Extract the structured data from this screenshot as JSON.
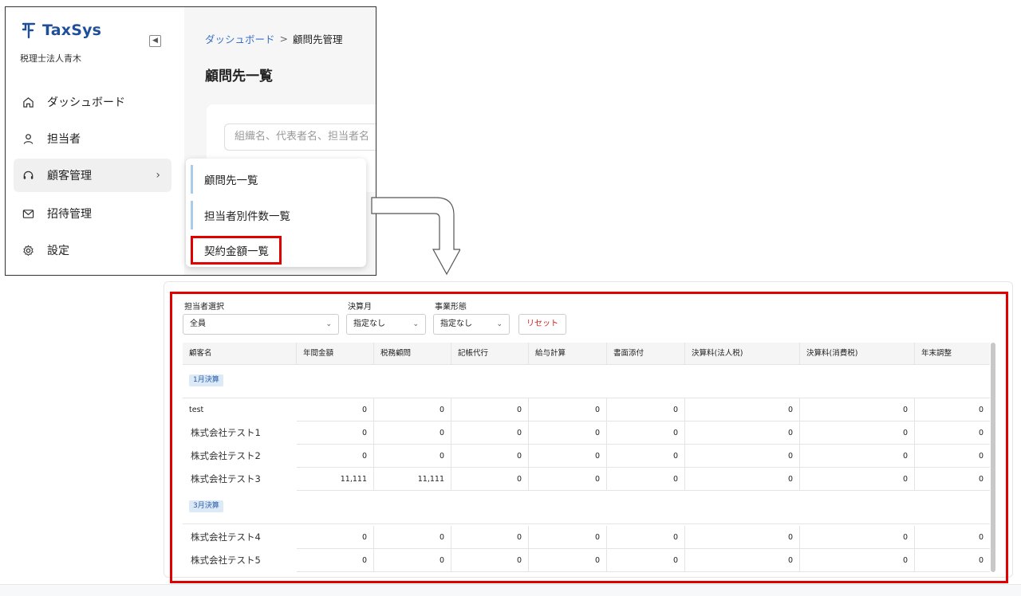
{
  "app": {
    "brand": "TaxSys",
    "org": "税理士法人青木",
    "nav": [
      {
        "label": "ダッシュボード",
        "icon": "home-icon"
      },
      {
        "label": "担当者",
        "icon": "user-icon"
      },
      {
        "label": "顧客管理",
        "icon": "headset-icon",
        "chevron": "›"
      },
      {
        "label": "招待管理",
        "icon": "mail-icon"
      },
      {
        "label": "設定",
        "icon": "gear-icon"
      }
    ],
    "breadcrumb": {
      "parent": "ダッシュボード",
      "sep": ">",
      "current": "顧問先管理"
    },
    "page_title": "顧問先一覧",
    "search_placeholder": "組織名、代表者名、担当者名",
    "flyout": [
      "顧問先一覧",
      "担当者別件数一覧",
      "契約金額一覧"
    ]
  },
  "filters": {
    "staff_label": "担当者選択",
    "staff_value": "全員",
    "month_label": "決算月",
    "month_value": "指定なし",
    "type_label": "事業形態",
    "type_value": "指定なし",
    "reset": "リセット"
  },
  "table": {
    "columns": [
      "顧客名",
      "年間金額",
      "税務顧問",
      "記帳代行",
      "給与計算",
      "書面添付",
      "決算料(法人税)",
      "決算料(消費税)",
      "年末調整"
    ],
    "groups": [
      {
        "tag": "1月決算",
        "rows": [
          {
            "name": "test",
            "values": [
              "0",
              "0",
              "0",
              "0",
              "0",
              "0",
              "0",
              "0"
            ]
          },
          {
            "name": "株式会社テスト1",
            "values": [
              "0",
              "0",
              "0",
              "0",
              "0",
              "0",
              "0",
              "0"
            ]
          },
          {
            "name": "株式会社テスト2",
            "values": [
              "0",
              "0",
              "0",
              "0",
              "0",
              "0",
              "0",
              "0"
            ]
          },
          {
            "name": "株式会社テスト3",
            "values": [
              "11,111",
              "11,111",
              "0",
              "0",
              "0",
              "0",
              "0",
              "0"
            ]
          }
        ]
      },
      {
        "tag": "3月決算",
        "rows": [
          {
            "name": "株式会社テスト4",
            "values": [
              "0",
              "0",
              "0",
              "0",
              "0",
              "0",
              "0",
              "0"
            ]
          },
          {
            "name": "株式会社テスト5",
            "values": [
              "0",
              "0",
              "0",
              "0",
              "0",
              "0",
              "0",
              "0"
            ]
          }
        ]
      }
    ]
  },
  "colors": {
    "brand": "#1f4f99",
    "highlight": "#e00000",
    "link": "#3a6fc8",
    "tag_bg": "#dce9f7"
  }
}
